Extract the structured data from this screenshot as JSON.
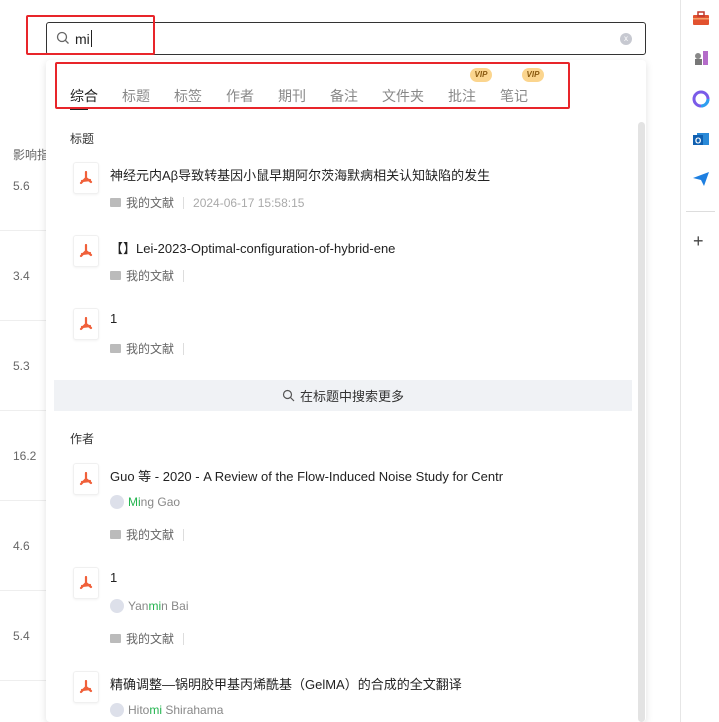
{
  "background": {
    "column_header": "影响指",
    "values": [
      "5.6",
      "3.4",
      "5.3",
      "16.2",
      "4.6",
      "5.4"
    ]
  },
  "search": {
    "value": "mi",
    "clear_label": "x"
  },
  "tabs": [
    {
      "label": "综合",
      "active": true
    },
    {
      "label": "标题"
    },
    {
      "label": "标签"
    },
    {
      "label": "作者"
    },
    {
      "label": "期刊"
    },
    {
      "label": "备注"
    },
    {
      "label": "文件夹"
    },
    {
      "label": "批注",
      "badge": "VIP"
    },
    {
      "label": "笔记",
      "badge": "VIP"
    }
  ],
  "title_section": {
    "label": "标题",
    "items": [
      {
        "title": "神经元内Aβ导致转基因小鼠早期阿尔茨海默病相关认知缺陷的发生",
        "folder": "我的文献",
        "date": "2024-06-17 15:58:15"
      },
      {
        "title": "【】Lei-2023-Optimal-configuration-of-hybrid-ene",
        "folder": "我的文献"
      },
      {
        "title": "1",
        "folder": "我的文献"
      }
    ],
    "more_label": "在标题中搜索更多"
  },
  "author_section": {
    "label": "作者",
    "items": [
      {
        "title": "Guo 等 - 2020 - A Review of the Flow-Induced Noise Study for Centr",
        "author_pre": "",
        "author_hl": "Mi",
        "author_post": "ng Gao",
        "folder": "我的文献"
      },
      {
        "title": "1",
        "author_pre": "Yan",
        "author_hl": "mi",
        "author_post": "n Bai",
        "folder": "我的文献"
      },
      {
        "title": "精确调整—锅明胶甲基丙烯酰基（GelMA）的合成的全文翻译",
        "author_pre": "Hito",
        "author_hl": "mi",
        "author_post": " Shirahama"
      }
    ]
  },
  "colors": {
    "highlight": "#22b34e",
    "annotation_box": "#e8252a",
    "pdf_icon": "#f0603a"
  }
}
